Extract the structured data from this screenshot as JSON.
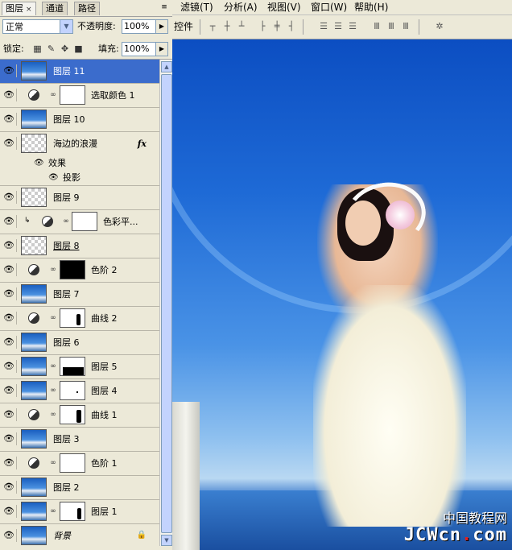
{
  "panel": {
    "tabs": [
      {
        "label": "图层",
        "active": true,
        "close": "×"
      },
      {
        "label": "通道",
        "active": false
      },
      {
        "label": "路径",
        "active": false
      }
    ],
    "menu_icon": "≡",
    "blend_mode": "正常",
    "opacity_label": "不透明度:",
    "opacity_value": "100%",
    "lock_label": "锁定:",
    "fill_label": "填充:",
    "fill_value": "100%",
    "lock_icons": [
      "lock-transparent-icon",
      "lock-pixels-icon",
      "lock-position-icon",
      "lock-all-icon"
    ]
  },
  "layers": [
    {
      "name": "图层 11",
      "type": "pixel",
      "thumb": "photo",
      "selected": true
    },
    {
      "name": "选取颜色 1",
      "type": "adjustment",
      "mask": "white"
    },
    {
      "name": "图层 10",
      "type": "pixel",
      "thumb": "photo"
    },
    {
      "name": "海边的浪漫",
      "type": "pixel",
      "thumb": "transparent",
      "fx": "fx",
      "effects_label": "效果",
      "effects": [
        "投影"
      ]
    },
    {
      "name": "图层 9",
      "type": "pixel",
      "thumb": "transparent"
    },
    {
      "name": "色彩平...",
      "type": "adjustment",
      "mask": "white",
      "clipped": true
    },
    {
      "name": "图层 8",
      "type": "pixel",
      "thumb": "transparent",
      "underline": true
    },
    {
      "name": "色阶 2",
      "type": "adjustment",
      "mask": "black"
    },
    {
      "name": "图层 7",
      "type": "pixel",
      "thumb": "photo"
    },
    {
      "name": "曲线 2",
      "type": "adjustment",
      "mask": "figure"
    },
    {
      "name": "图层 6",
      "type": "pixel",
      "thumb": "photo"
    },
    {
      "name": "图层 5",
      "type": "pixel",
      "thumb": "photo",
      "mask": "figure"
    },
    {
      "name": "图层 4",
      "type": "pixel",
      "thumb": "photo",
      "mask": "white"
    },
    {
      "name": "曲线 1",
      "type": "adjustment",
      "mask": "figure"
    },
    {
      "name": "图层 3",
      "type": "pixel",
      "thumb": "photo"
    },
    {
      "name": "色阶 1",
      "type": "adjustment",
      "mask": "white"
    },
    {
      "name": "图层 2",
      "type": "pixel",
      "thumb": "photo"
    },
    {
      "name": "图层 1",
      "type": "pixel",
      "thumb": "photo",
      "mask": "figure"
    },
    {
      "name": "背景",
      "type": "background",
      "thumb": "photo",
      "locked": true
    }
  ],
  "menubar": [
    {
      "label": "滤镜(T)"
    },
    {
      "label": "分析(A)"
    },
    {
      "label": "视图(V)"
    },
    {
      "label": "窗口(W)"
    },
    {
      "label": "帮助(H)"
    }
  ],
  "options": {
    "label": "控件",
    "align_icons": [
      "align-top-icon",
      "align-vcenter-icon",
      "align-bottom-icon",
      "align-left-icon",
      "align-hcenter-icon",
      "align-right-icon",
      "distribute-top-icon",
      "distribute-vcenter-icon",
      "distribute-bottom-icon",
      "distribute-left-icon",
      "distribute-hcenter-icon",
      "distribute-right-icon",
      "auto-align-icon"
    ]
  },
  "watermark": {
    "line1": "中国教程网",
    "line2_a": "JCW",
    "line2_b": "cn",
    "line2_dot": ".",
    "line2_c": "com"
  }
}
